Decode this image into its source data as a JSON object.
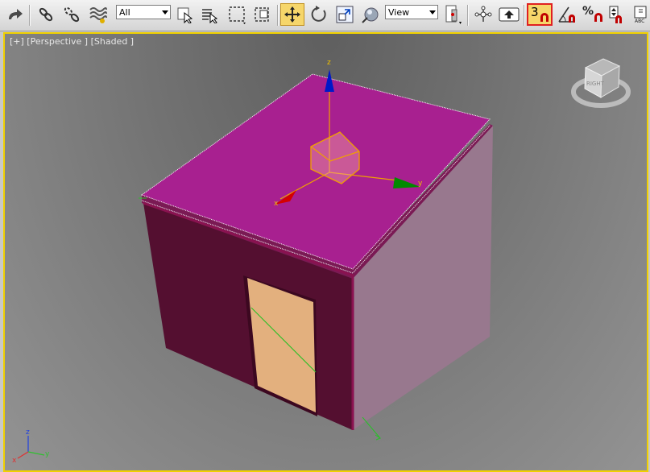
{
  "toolbar": {
    "selection_filter": "All",
    "reference_coord": "View",
    "snap_toggle_label": "3",
    "percent_snap_label": "%"
  },
  "viewport": {
    "label": "[+] [Perspective ] [Shaded ]",
    "gizmo_axes": {
      "x": "x",
      "y": "y",
      "z": "z"
    },
    "triad_axes": {
      "x": "x",
      "y": "y",
      "z": "z"
    },
    "viewcube_face": "RIGHT"
  },
  "colors": {
    "selection_border": "#f0d000",
    "roof": "#a82090",
    "front_wall": "#540f30",
    "side_wall": "#98788e",
    "door": "#e3b07e",
    "gizmo_x": "#d40000",
    "gizmo_y": "#00a000",
    "gizmo_z": "#0000d0",
    "gizmo_center": "#f0a000"
  }
}
